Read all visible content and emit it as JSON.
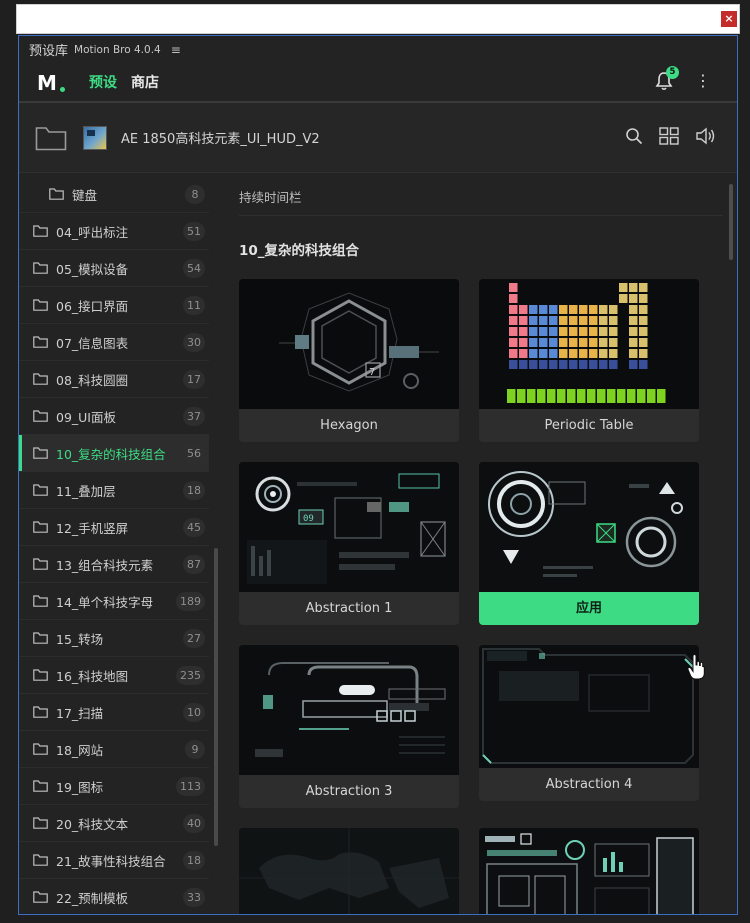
{
  "panel": {
    "title": "预设库",
    "app": "Motion Bro 4.0.4",
    "menu_glyph": "≡"
  },
  "nav": {
    "logo": "M",
    "tabs": [
      "预设",
      "商店"
    ],
    "notifications": "5"
  },
  "path": {
    "title": "AE 1850高科技元素_UI_HUD_V2"
  },
  "sidebar": {
    "items": [
      {
        "label": "键盘",
        "count": "8",
        "sub": true
      },
      {
        "label": "04_呼出标注",
        "count": "51"
      },
      {
        "label": "05_模拟设备",
        "count": "54"
      },
      {
        "label": "06_接口界面",
        "count": "11"
      },
      {
        "label": "07_信息图表",
        "count": "30"
      },
      {
        "label": "08_科技圆圈",
        "count": "17"
      },
      {
        "label": "09_UI面板",
        "count": "37"
      },
      {
        "label": "10_复杂的科技组合",
        "count": "56",
        "active": true
      },
      {
        "label": "11_叠加层",
        "count": "18"
      },
      {
        "label": "12_手机竖屏",
        "count": "45"
      },
      {
        "label": "13_组合科技元素",
        "count": "87"
      },
      {
        "label": "14_单个科技字母",
        "count": "189"
      },
      {
        "label": "15_转场",
        "count": "27"
      },
      {
        "label": "16_科技地图",
        "count": "235"
      },
      {
        "label": "17_扫描",
        "count": "10"
      },
      {
        "label": "18_网站",
        "count": "9"
      },
      {
        "label": "19_图标",
        "count": "113"
      },
      {
        "label": "20_科技文本",
        "count": "40"
      },
      {
        "label": "21_故事性科技组合",
        "count": "18"
      },
      {
        "label": "22_预制模板",
        "count": "33"
      }
    ]
  },
  "content": {
    "breadcrumb": "持续时间栏",
    "section_title": "10_复杂的科技组合",
    "cards": [
      {
        "label": "Hexagon"
      },
      {
        "label": "Periodic Table"
      },
      {
        "label": "Abstraction 1"
      },
      {
        "label": "应用"
      },
      {
        "label": "Abstraction 3"
      },
      {
        "label": "Abstraction 4"
      }
    ]
  },
  "colors": {
    "accent": "#3ddc84",
    "background": "#232323",
    "card": "#2d2d2d",
    "window_border": "#3a6fc4"
  }
}
